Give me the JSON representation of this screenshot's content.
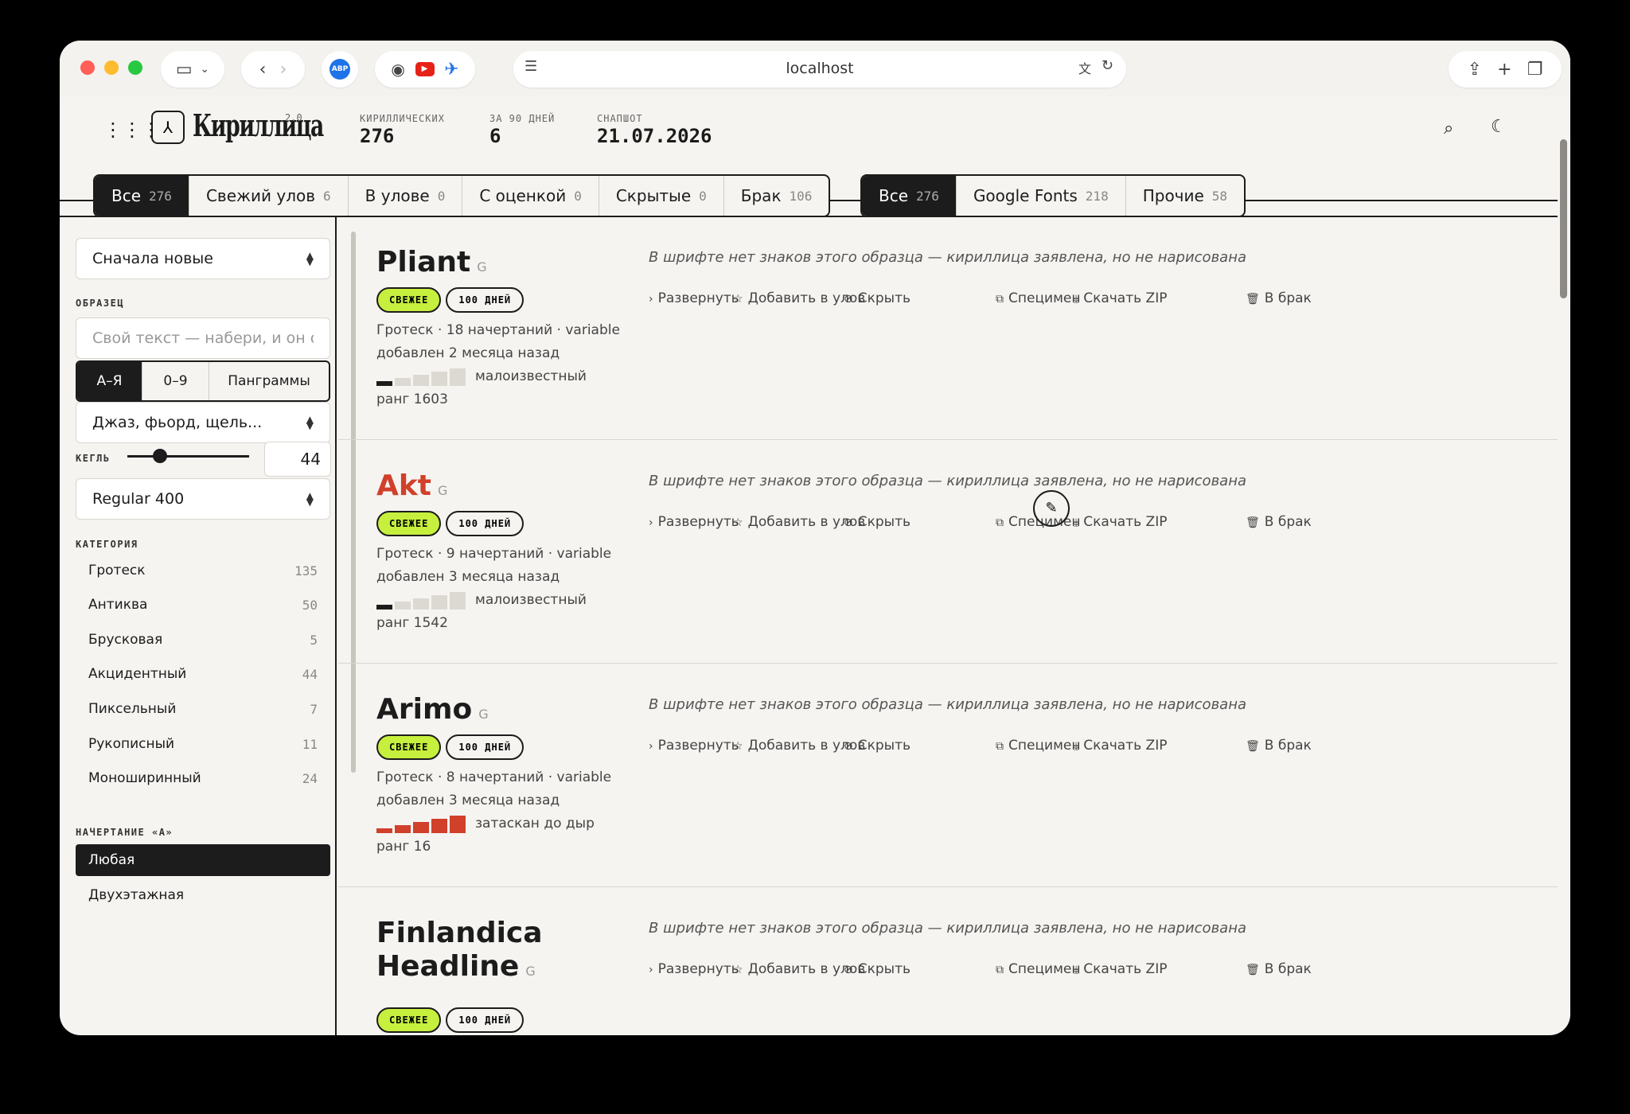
{
  "browser": {
    "url": "localhost"
  },
  "header": {
    "logo_text": "Кириллица",
    "logo_version": "2.0",
    "stats": [
      {
        "label": "КИРИЛЛИЧЕСКИХ",
        "value": "276"
      },
      {
        "label": "ЗА 90 ДНЕЙ",
        "value": "6"
      },
      {
        "label": "СНАПШОТ",
        "value": "21.07.2026"
      }
    ]
  },
  "status_tabs": [
    {
      "label": "Все",
      "count": "276",
      "active": true
    },
    {
      "label": "Свежий улов",
      "count": "6"
    },
    {
      "label": "В улове",
      "count": "0"
    },
    {
      "label": "С оценкой",
      "count": "0"
    },
    {
      "label": "Скрытые",
      "count": "0"
    },
    {
      "label": "Брак",
      "count": "106"
    }
  ],
  "source_tabs": [
    {
      "label": "Все",
      "count": "276",
      "active": true
    },
    {
      "label": "Google Fonts",
      "count": "218"
    },
    {
      "label": "Прочие",
      "count": "58"
    }
  ],
  "sidebar": {
    "sort_value": "Сначала новые",
    "sample_label": "ОБРАЗЕЦ",
    "sample_placeholder": "Свой текст — набери, и он ст",
    "sample_modes": [
      "А–Я",
      "0–9",
      "Панграммы"
    ],
    "sample_preset": "Джаз, фьорд, щель...",
    "size_label": "КЕГЛЬ",
    "size_value": "44",
    "weight_value": "Regular 400",
    "category_label": "КАТЕГОРИЯ",
    "categories": [
      {
        "name": "Гротеск",
        "count": "135"
      },
      {
        "name": "Антиква",
        "count": "50"
      },
      {
        "name": "Брусковая",
        "count": "5"
      },
      {
        "name": "Акцидентный",
        "count": "44"
      },
      {
        "name": "Пиксельный",
        "count": "7"
      },
      {
        "name": "Рукописный",
        "count": "11"
      },
      {
        "name": "Моноширинный",
        "count": "24"
      }
    ],
    "style_label": "НАЧЕРТАНИЕ «А»",
    "styles": [
      "Любая",
      "Двухэтажная"
    ]
  },
  "card_actions": {
    "expand": "Развернуть",
    "add": "Добавить в улов",
    "hide": "Скрыть",
    "specimen": "Специмен",
    "download": "Скачать ZIP",
    "reject": "В брак"
  },
  "sample_notice": "В шрифте нет знаков этого образца — кириллица заявлена, но не нарисована",
  "colors": {
    "accent_fresh": "#c6ef3e",
    "hot_red": "#d0402b",
    "ink": "#1c1c1c"
  },
  "fonts": [
    {
      "name": "Pliant",
      "source_mark": "G",
      "badge_fresh": "СВЕЖЕЕ",
      "badge_days": "100 ДНЕЙ",
      "meta": "Гротеск · 18 начертаний · variable",
      "added": "добавлен 2 месяца назад",
      "popularity_label": "малоизвестный",
      "popularity_level": 1,
      "rank": "ранг 1603",
      "name_color": "#1c1c1c"
    },
    {
      "name": "Akt",
      "source_mark": "G",
      "badge_fresh": "СВЕЖЕЕ",
      "badge_days": "100 ДНЕЙ",
      "meta": "Гротеск · 9 начертаний · variable",
      "added": "добавлен 3 месяца назад",
      "popularity_label": "малоизвестный",
      "popularity_level": 1,
      "rank": "ранг 1542",
      "name_color": "#d0402b"
    },
    {
      "name": "Arimo",
      "source_mark": "G",
      "badge_fresh": "СВЕЖЕЕ",
      "badge_days": "100 ДНЕЙ",
      "meta": "Гротеск · 8 начертаний · variable",
      "added": "добавлен 3 месяца назад",
      "popularity_label": "затаскан до дыр",
      "popularity_level": 5,
      "rank": "ранг 16",
      "name_color": "#1c1c1c"
    },
    {
      "name": "Finlandica Headline",
      "source_mark": "G",
      "badge_fresh": "СВЕЖЕЕ",
      "badge_days": "100 ДНЕЙ",
      "name_color": "#1c1c1c"
    }
  ]
}
